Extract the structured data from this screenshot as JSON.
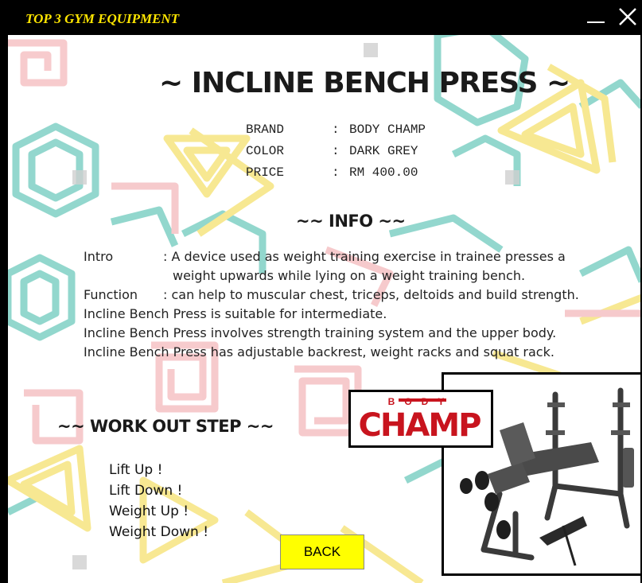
{
  "window": {
    "title": "TOP 3 GYM EQUIPMENT",
    "minimize_label": "—",
    "close_label": "✕"
  },
  "product": {
    "title": "~ INCLINE BENCH PRESS ~",
    "specs": [
      {
        "label": "BRAND",
        "sep": ":",
        "value": "BODY CHAMP"
      },
      {
        "label": "COLOR",
        "sep": ":",
        "value": "DARK GREY"
      },
      {
        "label": "PRICE",
        "sep": ":",
        "value": "RM 400.00"
      }
    ]
  },
  "info": {
    "heading": "~~ INFO ~~",
    "intro_key": "Intro",
    "intro_val": ": A device used as weight training exercise in trainee presses a",
    "intro_cont": "weight upwards while lying on a weight training bench.",
    "function_key": "Function",
    "function_val": ": can help to muscular chest, triceps, deltoids and build strength.",
    "line1": "Incline Bench Press is suitable for intermediate.",
    "line2": "Incline Bench Press involves strength training system and the upper body.",
    "line3": "Incline Bench Press has adjustable backrest, weight racks and squat rack."
  },
  "workout": {
    "heading": "~~ WORK OUT STEP ~~",
    "steps": [
      "Lift Up !",
      "Lift Down !",
      "Weight Up !",
      "Weight Down !"
    ]
  },
  "buttons": {
    "back": "BACK"
  },
  "logo": {
    "top_text": "BODY",
    "main_text": "CHAMP",
    "color": "#c8141e"
  },
  "colors": {
    "title_bar": "#000000",
    "title_text": "#ffe600",
    "back_button": "#ffff00"
  }
}
